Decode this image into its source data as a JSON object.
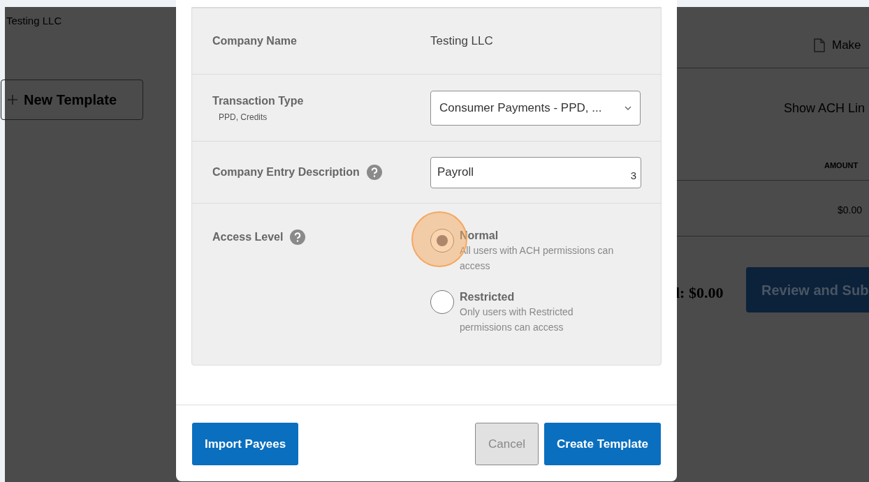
{
  "background_page": {
    "company": "Testing LLC",
    "new_template_button": "New Template",
    "make_link": "Make",
    "show_ach_link": "Show ACH Lin",
    "amount_header": "AMOUNT",
    "amount_cell": "$0.00",
    "total": "l: $0.00",
    "review_button": "Review and Sub"
  },
  "modal": {
    "fields": [
      {
        "kind": "text",
        "label": "Company Name",
        "value": "Testing LLC"
      },
      {
        "kind": "select",
        "label": "Transaction Type",
        "sublabel": "PPD, Credits",
        "value": "Consumer Payments - PPD, ..."
      },
      {
        "kind": "input",
        "label": "Company Entry Description",
        "help": true,
        "value": "Payroll",
        "counter": "3"
      },
      {
        "kind": "radio",
        "label": "Access Level",
        "help": true,
        "options": [
          {
            "label": "Normal",
            "description": "All users with ACH permissions can access",
            "selected": true,
            "clicked": true
          },
          {
            "label": "Restricted",
            "description": "Only users with Restricted permissions can access",
            "selected": false,
            "clicked": false
          }
        ]
      }
    ],
    "buttons": [
      {
        "label": "Import Payees",
        "kind": "primary"
      },
      {
        "label": "Cancel",
        "kind": "secondary"
      },
      {
        "label": "Create Template",
        "kind": "primary"
      }
    ]
  }
}
